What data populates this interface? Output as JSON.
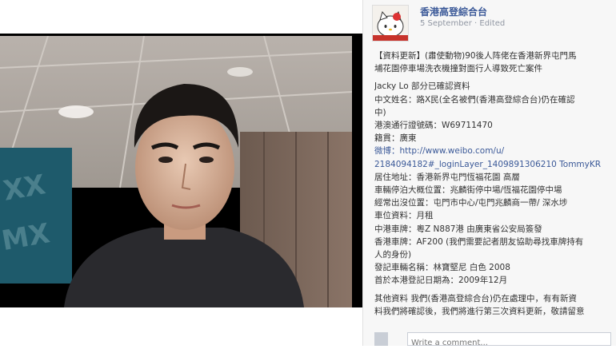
{
  "post": {
    "page_name": "香港高登綜合台",
    "date": "5 September",
    "separator": " · ",
    "edited": "Edited",
    "lines": [
      "【資料更新】(肅使動物)90後人阵佬在香港新界屯門馬",
      "埔花園停車場洗衣機撞對面行人導致死亡案件",
      "",
      "Jacky Lo 部分已確認資料",
      "中文姓名：路X民(全名被們(香港高登綜合台)仍在確認",
      "中)",
      "港澳通行證號碼：W69711470",
      "籍貫：廣東",
      "微博：http://www.weibo.com/u/",
      "2184094182#_loginLayer_1409891306210 TommyKR",
      "居住地址：香港新界屯門恆福花園 高層",
      "車輛停泊大概位置：兆麟街停中場/恆福花園停中場",
      "經常出沒位置：屯門市中心/屯門兆麟商一帶/ 深水埗",
      "車位資料：月租",
      "中港車牌：粵Z N887港 由廣東省公安局簽發",
      "香港車牌：AF200 (我們需要記者朋友協助尋找車牌持有",
      "人的身份)",
      "發記車輛名稱：林寶堅尼 白色 2008",
      "首於本港登記日期為：2009年12月",
      "",
      "其他資料 我們(香港高登綜合台)仍在處理中，有有新資",
      "料我們將確認後，我們將進行第三次資料更新，敬請留意"
    ],
    "comment_placeholder": "Write a comment..."
  },
  "colors": {
    "link": "#3b5998",
    "meta": "#9197a3",
    "text": "#333333"
  },
  "icons": {
    "avatar": "hello-kitty-avatar-icon"
  }
}
